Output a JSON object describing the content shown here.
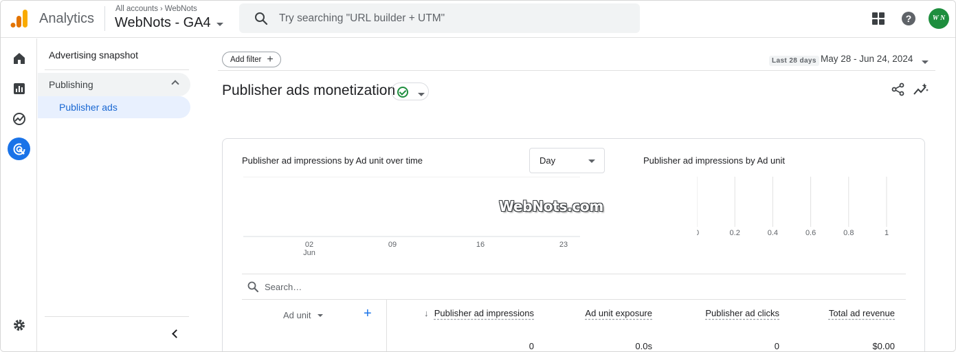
{
  "app": {
    "name": "Analytics"
  },
  "breadcrumb": {
    "root": "All accounts",
    "account": "WebNots"
  },
  "property": {
    "name": "WebNots - GA4"
  },
  "search": {
    "placeholder": "Try searching \"URL builder + UTM\""
  },
  "avatar": {
    "initials": "W N",
    "color": "#1e8e3e"
  },
  "rail": {
    "items": [
      "home-icon",
      "reports-icon",
      "explore-icon",
      "advertising-icon"
    ],
    "active": "advertising-icon",
    "bottom": "settings-icon"
  },
  "sidenav": {
    "title": "Advertising snapshot",
    "group": "Publishing",
    "active_item": "Publisher ads"
  },
  "toolbar": {
    "add_filter": "Add filter",
    "date_prefix": "Last 28 days",
    "date_range": "May 28 - Jun 24, 2024"
  },
  "page": {
    "title": "Publisher ads monetization"
  },
  "card": {
    "chart1_title": "Publisher ad impressions by Ad unit over time",
    "granularity": "Day",
    "chart2_title": "Publisher ad impressions by Ad unit",
    "watermark": "WebNots.com"
  },
  "chart_data": [
    {
      "type": "line",
      "title": "Publisher ad impressions by Ad unit over time",
      "x_ticks": [
        "02",
        "09",
        "16",
        "23"
      ],
      "x_tick_sub": [
        "Jun",
        "",
        "",
        ""
      ],
      "series": []
    },
    {
      "type": "bar",
      "title": "Publisher ad impressions by Ad unit",
      "x_ticks": [
        "0",
        "0.2",
        "0.4",
        "0.6",
        "0.8",
        "1"
      ],
      "categories": [],
      "values": []
    }
  ],
  "table": {
    "search_placeholder": "Search…",
    "dimension": "Ad unit",
    "add_dimension": "+",
    "sort_arrow": "↓",
    "metrics": [
      {
        "label": "Publisher ad impressions",
        "total": "0"
      },
      {
        "label": "Ad unit exposure",
        "total": "0.0s"
      },
      {
        "label": "Publisher ad clicks",
        "total": "0"
      },
      {
        "label": "Total ad revenue",
        "total": "$0.00"
      }
    ]
  },
  "colors": {
    "accent": "#1a73e8",
    "active_nav_bg": "#e8f0fe",
    "active_nav_text": "#1967d2",
    "logo_orange": "#f9ab00",
    "logo_dark_orange": "#e37400"
  }
}
